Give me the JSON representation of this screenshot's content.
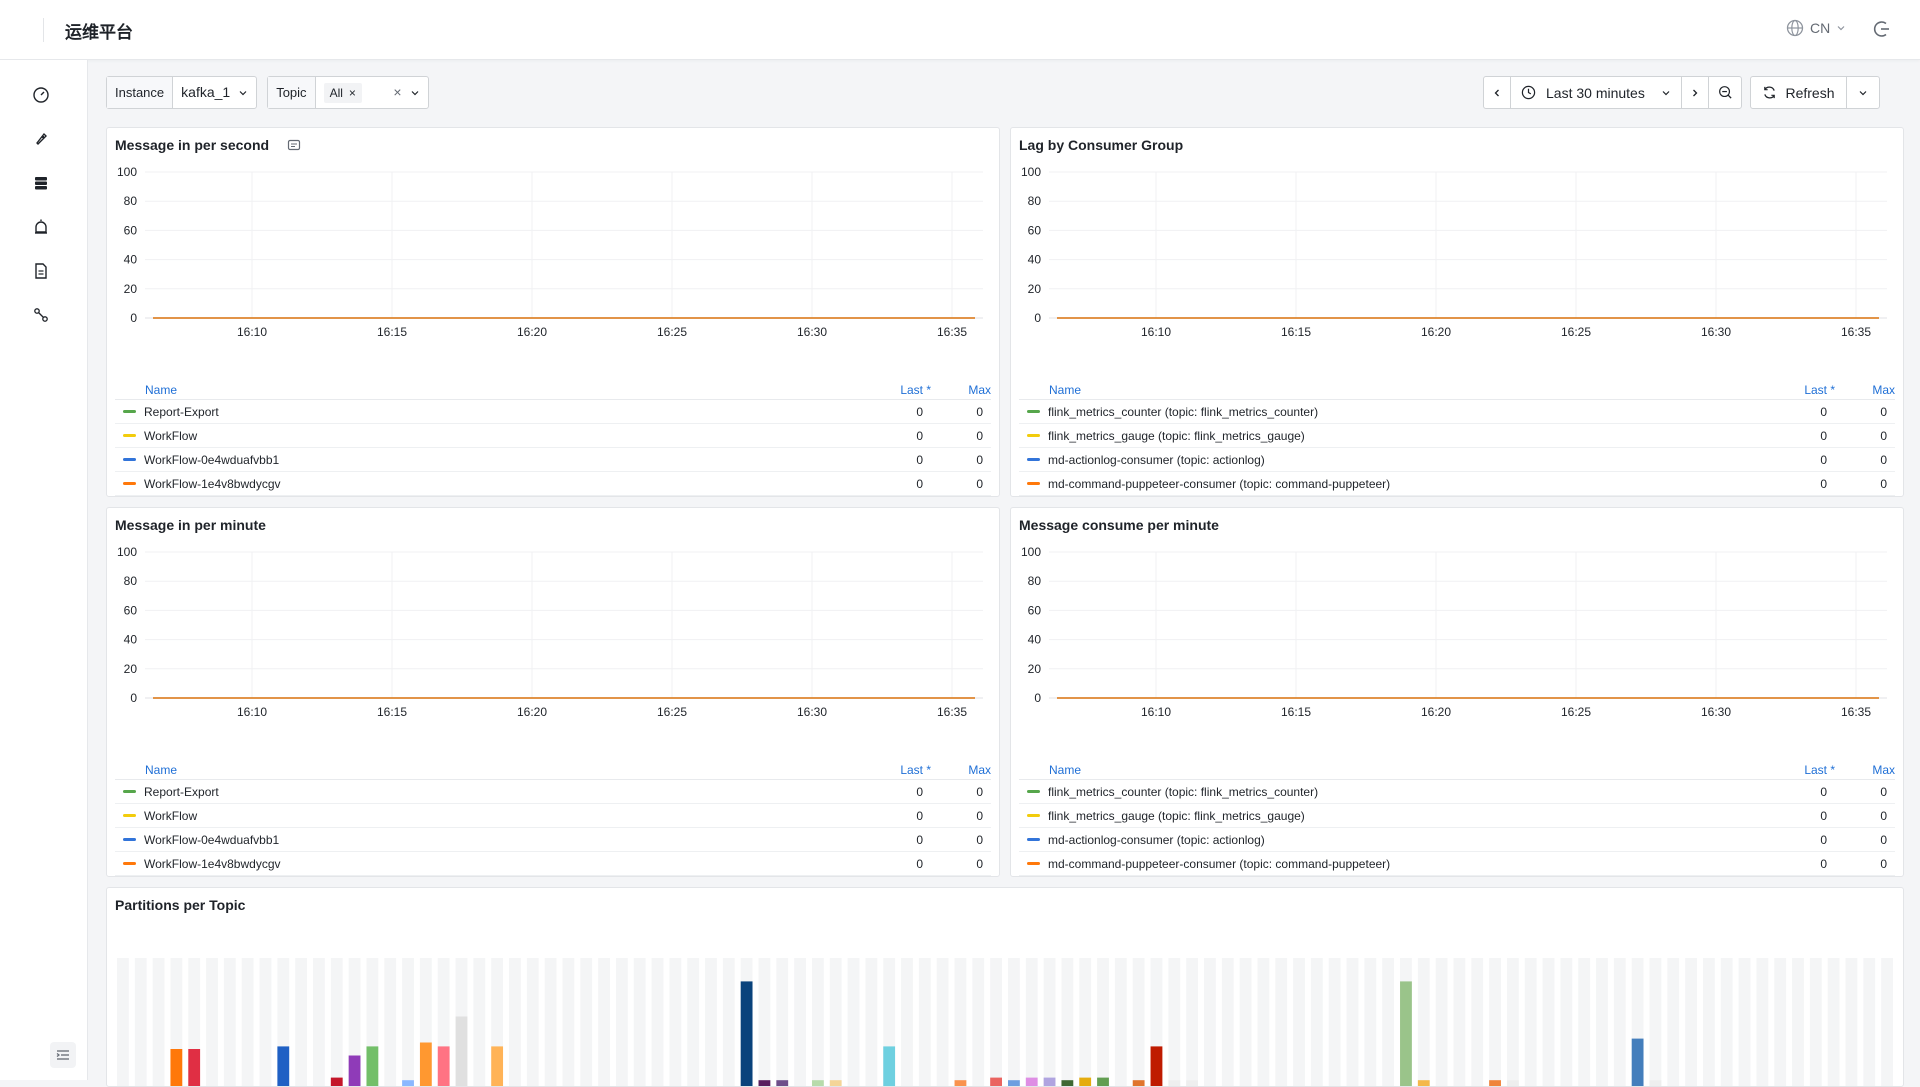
{
  "header": {
    "title": "运维平台",
    "lang": "CN"
  },
  "sidebar": {
    "items": [
      "dashboard-icon",
      "rocket-icon",
      "database-icon",
      "alarm-icon",
      "document-icon",
      "topology-icon"
    ]
  },
  "toolbar": {
    "instance_label": "Instance",
    "instance_value": "kafka_1",
    "topic_label": "Topic",
    "topic_value": "All"
  },
  "timebar": {
    "range": "Last 30 minutes",
    "refresh": "Refresh"
  },
  "legend_headers": {
    "name": "Name",
    "last": "Last *",
    "max": "Max"
  },
  "colors": {
    "green": "#56a64b",
    "yellow": "#f2cc0c",
    "blue": "#3274d9",
    "orange": "#ff780a"
  },
  "panels": [
    {
      "title": "Message in per second",
      "x_ticks": [
        "16:10",
        "16:15",
        "16:20",
        "16:25",
        "16:30",
        "16:35"
      ],
      "y_ticks": [
        "0",
        "20",
        "40",
        "60",
        "80",
        "100"
      ],
      "series": [
        {
          "name": "Report-Export",
          "last": "0",
          "max": "0"
        },
        {
          "name": "WorkFlow",
          "last": "0",
          "max": "0"
        },
        {
          "name": "WorkFlow-0e4wduafvbb1",
          "last": "0",
          "max": "0"
        },
        {
          "name": "WorkFlow-1e4v8bwdycgv",
          "last": "0",
          "max": "0"
        }
      ]
    },
    {
      "title": "Lag by Consumer Group",
      "x_ticks": [
        "16:10",
        "16:15",
        "16:20",
        "16:25",
        "16:30",
        "16:35"
      ],
      "y_ticks": [
        "0",
        "20",
        "40",
        "60",
        "80",
        "100"
      ],
      "series": [
        {
          "name": "flink_metrics_counter (topic: flink_metrics_counter)",
          "last": "0",
          "max": "0"
        },
        {
          "name": "flink_metrics_gauge (topic: flink_metrics_gauge)",
          "last": "0",
          "max": "0"
        },
        {
          "name": "md-actionlog-consumer (topic: actionlog)",
          "last": "0",
          "max": "0"
        },
        {
          "name": "md-command-puppeteer-consumer (topic: command-puppeteer)",
          "last": "0",
          "max": "0"
        }
      ]
    },
    {
      "title": "Message in per minute",
      "x_ticks": [
        "16:10",
        "16:15",
        "16:20",
        "16:25",
        "16:30",
        "16:35"
      ],
      "y_ticks": [
        "0",
        "20",
        "40",
        "60",
        "80",
        "100"
      ],
      "series": [
        {
          "name": "Report-Export",
          "last": "0",
          "max": "0"
        },
        {
          "name": "WorkFlow",
          "last": "0",
          "max": "0"
        },
        {
          "name": "WorkFlow-0e4wduafvbb1",
          "last": "0",
          "max": "0"
        },
        {
          "name": "WorkFlow-1e4v8bwdycgv",
          "last": "0",
          "max": "0"
        }
      ]
    },
    {
      "title": "Message consume per minute",
      "x_ticks": [
        "16:10",
        "16:15",
        "16:20",
        "16:25",
        "16:30",
        "16:35"
      ],
      "y_ticks": [
        "0",
        "20",
        "40",
        "60",
        "80",
        "100"
      ],
      "series": [
        {
          "name": "flink_metrics_counter (topic: flink_metrics_counter)",
          "last": "0",
          "max": "0"
        },
        {
          "name": "flink_metrics_gauge (topic: flink_metrics_gauge)",
          "last": "0",
          "max": "0"
        },
        {
          "name": "md-actionlog-consumer (topic: actionlog)",
          "last": "0",
          "max": "0"
        },
        {
          "name": "md-command-puppeteer-consumer (topic: command-puppeteer)",
          "last": "0",
          "max": "0"
        }
      ]
    }
  ],
  "partitions_panel": {
    "title": "Partitions per Topic"
  },
  "chart_data": [
    {
      "type": "line",
      "title": "Message in per second",
      "x": [
        "16:10",
        "16:15",
        "16:20",
        "16:25",
        "16:30",
        "16:35"
      ],
      "ylim": [
        0,
        100
      ],
      "grid": true,
      "series": [
        {
          "name": "Report-Export",
          "values": [
            0,
            0,
            0,
            0,
            0,
            0
          ]
        },
        {
          "name": "WorkFlow",
          "values": [
            0,
            0,
            0,
            0,
            0,
            0
          ]
        },
        {
          "name": "WorkFlow-0e4wduafvbb1",
          "values": [
            0,
            0,
            0,
            0,
            0,
            0
          ]
        },
        {
          "name": "WorkFlow-1e4v8bwdycgv",
          "values": [
            0,
            0,
            0,
            0,
            0,
            0
          ]
        }
      ]
    },
    {
      "type": "line",
      "title": "Lag by Consumer Group",
      "x": [
        "16:10",
        "16:15",
        "16:20",
        "16:25",
        "16:30",
        "16:35"
      ],
      "ylim": [
        0,
        100
      ],
      "grid": true,
      "series": [
        {
          "name": "flink_metrics_counter (topic: flink_metrics_counter)",
          "values": [
            0,
            0,
            0,
            0,
            0,
            0
          ]
        },
        {
          "name": "flink_metrics_gauge (topic: flink_metrics_gauge)",
          "values": [
            0,
            0,
            0,
            0,
            0,
            0
          ]
        },
        {
          "name": "md-actionlog-consumer (topic: actionlog)",
          "values": [
            0,
            0,
            0,
            0,
            0,
            0
          ]
        },
        {
          "name": "md-command-puppeteer-consumer (topic: command-puppeteer)",
          "values": [
            0,
            0,
            0,
            0,
            0,
            0
          ]
        }
      ]
    },
    {
      "type": "line",
      "title": "Message in per minute",
      "x": [
        "16:10",
        "16:15",
        "16:20",
        "16:25",
        "16:30",
        "16:35"
      ],
      "ylim": [
        0,
        100
      ],
      "grid": true,
      "series": [
        {
          "name": "Report-Export",
          "values": [
            0,
            0,
            0,
            0,
            0,
            0
          ]
        },
        {
          "name": "WorkFlow",
          "values": [
            0,
            0,
            0,
            0,
            0,
            0
          ]
        },
        {
          "name": "WorkFlow-0e4wduafvbb1",
          "values": [
            0,
            0,
            0,
            0,
            0,
            0
          ]
        },
        {
          "name": "WorkFlow-1e4v8bwdycgv",
          "values": [
            0,
            0,
            0,
            0,
            0,
            0
          ]
        }
      ]
    },
    {
      "type": "line",
      "title": "Message consume per minute",
      "x": [
        "16:10",
        "16:15",
        "16:20",
        "16:25",
        "16:30",
        "16:35"
      ],
      "ylim": [
        0,
        100
      ],
      "grid": true,
      "series": [
        {
          "name": "flink_metrics_counter (topic: flink_metrics_counter)",
          "values": [
            0,
            0,
            0,
            0,
            0,
            0
          ]
        },
        {
          "name": "flink_metrics_gauge (topic: flink_metrics_gauge)",
          "values": [
            0,
            0,
            0,
            0,
            0,
            0
          ]
        },
        {
          "name": "md-actionlog-consumer (topic: actionlog)",
          "values": [
            0,
            0,
            0,
            0,
            0,
            0
          ]
        },
        {
          "name": "md-command-puppeteer-consumer (topic: command-puppeteer)",
          "values": [
            0,
            0,
            0,
            0,
            0,
            0
          ]
        }
      ]
    },
    {
      "type": "bar",
      "title": "Partitions per Topic",
      "values": [
        0,
        0,
        0,
        30,
        30,
        0,
        0,
        0,
        0,
        32,
        0,
        0,
        8,
        25,
        32,
        0,
        6,
        35,
        32,
        55,
        0,
        32,
        0,
        0,
        0,
        0,
        0,
        0,
        0,
        0,
        0,
        0,
        0,
        0,
        0,
        82,
        6,
        6,
        0,
        6,
        6,
        0,
        0,
        32,
        0,
        0,
        0,
        6,
        0,
        8,
        6,
        8,
        8,
        6,
        8,
        8,
        0,
        6,
        32,
        6,
        6,
        0,
        0,
        0,
        0,
        0,
        0,
        0,
        0,
        0,
        0,
        0,
        82,
        6,
        0,
        0,
        0,
        6,
        6,
        0,
        0,
        0,
        0,
        0,
        0,
        38,
        6,
        0,
        0,
        0,
        0,
        0,
        0,
        0,
        0,
        0,
        0,
        0,
        0,
        0
      ],
      "colors": [
        "#eee",
        "#eee",
        "#eee",
        "#ff780a",
        "#e02f44",
        "#eee",
        "#eee",
        "#eee",
        "#eee",
        "#1f60c4",
        "#eee",
        "#eee",
        "#c4162a",
        "#8f3bb8",
        "#73bf69",
        "#fade2a",
        "#8ab8ff",
        "#ff9830",
        "#ff7383",
        "#e0e0e0",
        "#eee",
        "#ffb357",
        "#eee",
        "#eee",
        "#eee",
        "#eee",
        "#eee",
        "#eee",
        "#eee",
        "#eee",
        "#eee",
        "#eee",
        "#eee",
        "#eee",
        "#eee",
        "#0a437c",
        "#5a1e5e",
        "#6e4e8a",
        "#eee",
        "#b7dbab",
        "#f4d598",
        "#eee",
        "#eee",
        "#6ed0e0",
        "#eee",
        "#eee",
        "#eee",
        "#f9934e",
        "#eee",
        "#ea6460",
        "#6d9ee0",
        "#de8ee4",
        "#b0a4e0",
        "#3f6833",
        "#e5ac0e",
        "#629e51",
        "#eee",
        "#e0752d",
        "#bf1b00",
        "#eee",
        "#eee",
        "#eee",
        "#eee",
        "#eee",
        "#eee",
        "#eee",
        "#eee",
        "#eee",
        "#eee",
        "#eee",
        "#eee",
        "#eee",
        "#9ac48a",
        "#f4b84a",
        "#64b0c8",
        "#eee",
        "#eee",
        "#ef843c",
        "#eee",
        "#eee",
        "#eee",
        "#eee",
        "#eee",
        "#eee",
        "#eee",
        "#447ebc",
        "#eee",
        "#eee",
        "#eee",
        "#584477",
        "#3f6833",
        "#eee",
        "#eee",
        "#eee",
        "#eee",
        "#eee",
        "#eee",
        "#eee",
        "#eee",
        "#eee"
      ]
    }
  ]
}
